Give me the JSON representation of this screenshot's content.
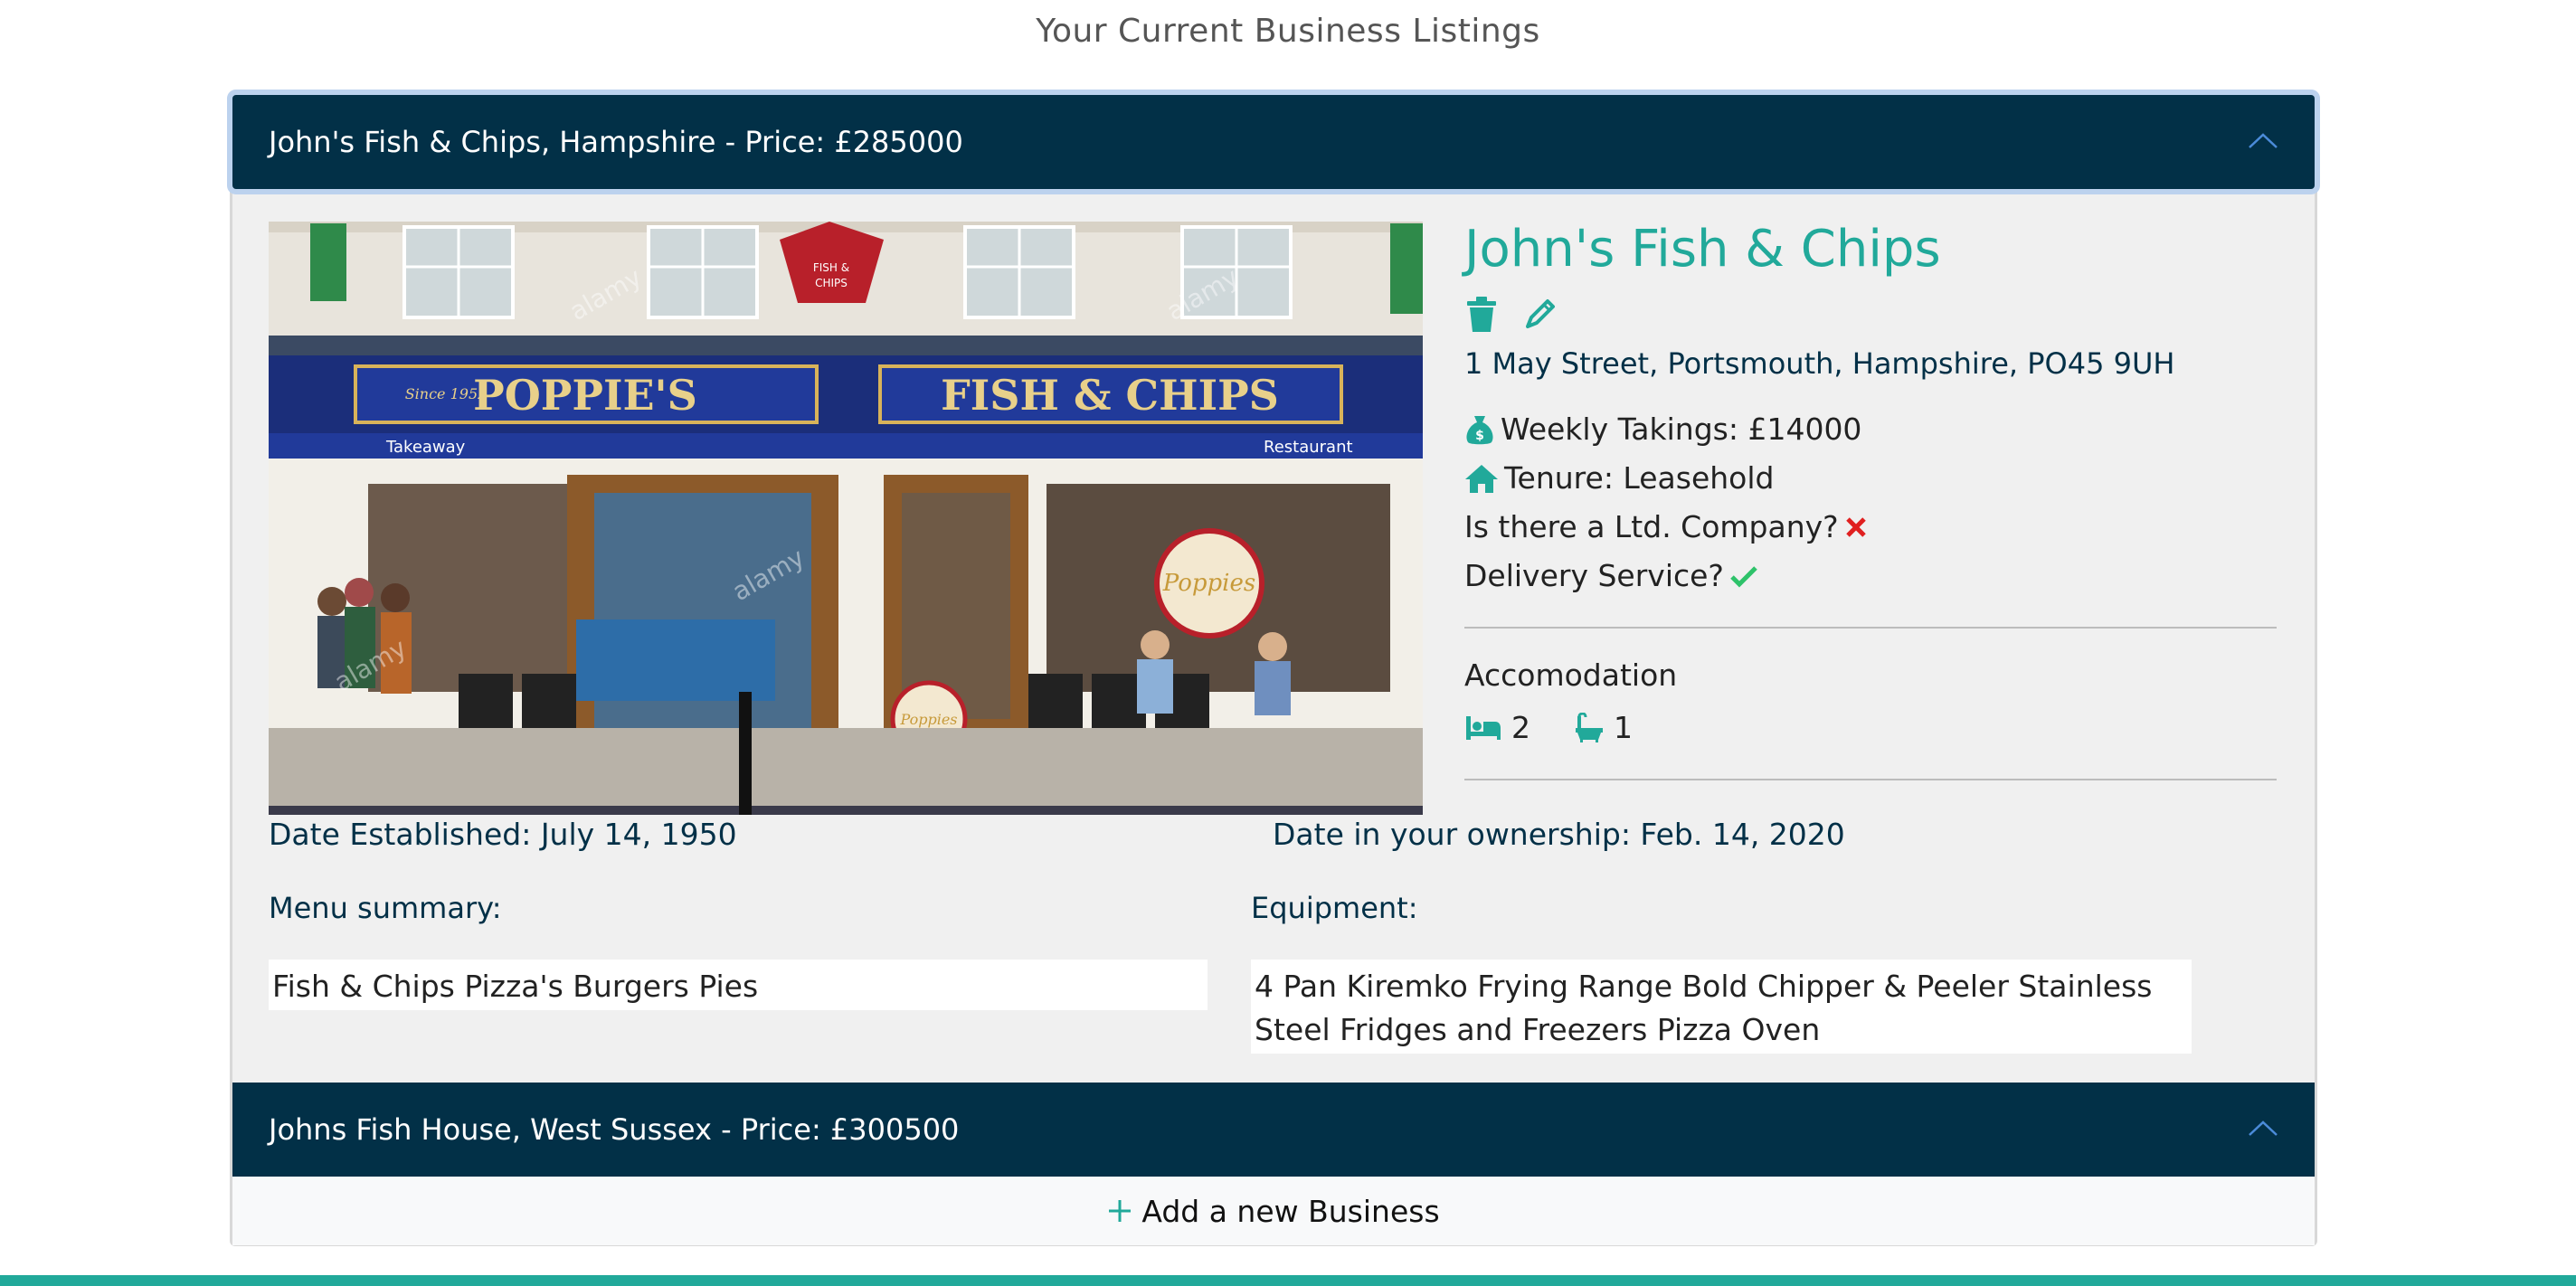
{
  "page": {
    "title": "Your Current Business Listings"
  },
  "listings": [
    {
      "header": "John's Fish & Chips, Hampshire - Price: £285000",
      "expanded": true,
      "name": "John's Fish & Chips",
      "address": "1 May Street, Portsmouth, Hampshire, PO45 9UH",
      "weekly_takings": "Weekly Takings: £14000",
      "tenure": "Tenure: Leasehold",
      "ltd_company_label": "Is there a Ltd. Company?",
      "ltd_company_value": false,
      "delivery_label": "Delivery Service?",
      "delivery_value": true,
      "accommodation_title": "Accomodation",
      "bedrooms": "2",
      "bathrooms": "1",
      "date_established": "Date Established: July 14, 1950",
      "date_owned": "Date in your ownership: Feb. 14, 2020",
      "menu_label": "Menu summary:",
      "menu_value": "Fish & Chips Pizza's Burgers Pies",
      "equipment_label": "Equipment:",
      "equipment_value": "4 Pan Kiremko Frying Range Bold Chipper & Peeler Stainless Steel Fridges and Freezers Pizza Oven",
      "photo": {
        "sign_left": "POPPIE'S",
        "sign_right": "FISH & CHIPS",
        "since_text": "Since 1952",
        "takeaway_text": "Takeaway",
        "restaurant_text": "Restaurant",
        "watermark": "alamy"
      }
    },
    {
      "header": "Johns Fish House, West Sussex - Price: £300500",
      "expanded": false
    }
  ],
  "actions": {
    "add_business": "Add a new Business"
  },
  "colors": {
    "header_bg": "#023047",
    "accent": "#21a99a",
    "cross": "#e02020",
    "check": "#2ec26a",
    "chevron": "#4b8bd9"
  },
  "icons": {
    "delete": "trash-icon",
    "edit": "pencil-icon",
    "takings": "money-bag-icon",
    "tenure": "house-icon",
    "bed": "bed-icon",
    "bath": "bath-icon",
    "collapse": "chevron-up-icon",
    "add": "plus-icon"
  }
}
